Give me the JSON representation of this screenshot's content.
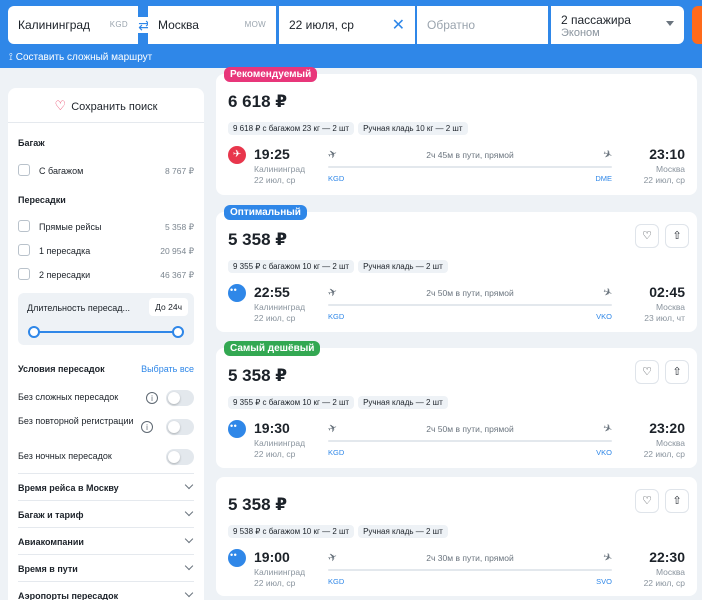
{
  "search": {
    "from": {
      "city": "Калининград",
      "code": "KGD"
    },
    "to": {
      "city": "Москва",
      "code": "MOW"
    },
    "date": "22 июля, ср",
    "return_placeholder": "Обратно",
    "passengers": "2 пассажира",
    "class": "Эконом",
    "complex_route": "Составить сложный маршрут"
  },
  "sidebar": {
    "save_search": "Сохранить поиск",
    "baggage": {
      "title": "Багаж",
      "items": [
        {
          "label": "С багажом",
          "price": "8 767 ₽"
        }
      ]
    },
    "transfers": {
      "title": "Пересадки",
      "items": [
        {
          "label": "Прямые рейсы",
          "price": "5 358 ₽"
        },
        {
          "label": "1 пересадка",
          "price": "20 954 ₽"
        },
        {
          "label": "2 пересадки",
          "price": "46 367 ₽"
        }
      ]
    },
    "duration": {
      "label": "Длительность пересад...",
      "value": "До 24ч"
    },
    "conditions": {
      "title": "Условия пересадок",
      "select_all": "Выбрать все",
      "items": [
        {
          "label": "Без сложных пересадок"
        },
        {
          "label": "Без повторной регистрации"
        },
        {
          "label": "Без ночных пересадок"
        }
      ]
    },
    "accordions": [
      "Время рейса в Москву",
      "Багаж и тариф",
      "Авиакомпании",
      "Время в пути",
      "Аэропорты пересадок"
    ]
  },
  "results": [
    {
      "badge": "Рекомендуемый",
      "badge_color": "#e8367a",
      "price": "6 618 ₽",
      "tags": [
        "9 618 ₽ с багажом 23 кг — 2 шт",
        "Ручная кладь 10 кг — 2 шт"
      ],
      "dep_time": "19:25",
      "dep_city": "Калининград",
      "dep_date": "22 июл, ср",
      "dep_code": "KGD",
      "duration": "2ч 45м в пути, прямой",
      "arr_time": "23:10",
      "arr_city": "Москва",
      "arr_date": "22 июл, ср",
      "arr_code": "DME",
      "airline": "red"
    },
    {
      "badge": "Оптимальный",
      "badge_color": "#2f87e8",
      "price": "5 358 ₽",
      "tags": [
        "9 355 ₽ с багажом 10 кг — 2 шт",
        "Ручная кладь — 2 шт"
      ],
      "dep_time": "22:55",
      "dep_city": "Калининград",
      "dep_date": "22 июл, ср",
      "dep_code": "KGD",
      "duration": "2ч 50м в пути, прямой",
      "arr_time": "02:45",
      "arr_city": "Москва",
      "arr_date": "23 июл, чт",
      "arr_code": "VKO",
      "airline": "blue"
    },
    {
      "badge": "Самый дешёвый",
      "badge_color": "#33a852",
      "price": "5 358 ₽",
      "tags": [
        "9 355 ₽ с багажом 10 кг — 2 шт",
        "Ручная кладь — 2 шт"
      ],
      "dep_time": "19:30",
      "dep_city": "Калининград",
      "dep_date": "22 июл, ср",
      "dep_code": "KGD",
      "duration": "2ч 50м в пути, прямой",
      "arr_time": "23:20",
      "arr_city": "Москва",
      "arr_date": "22 июл, ср",
      "arr_code": "VKO",
      "airline": "blue"
    },
    {
      "badge": "",
      "badge_color": "",
      "price": "5 358 ₽",
      "tags": [
        "9 538 ₽ с багажом 10 кг — 2 шт",
        "Ручная кладь — 2 шт"
      ],
      "dep_time": "19:00",
      "dep_city": "Калининград",
      "dep_date": "22 июл, ср",
      "dep_code": "KGD",
      "duration": "2ч 30м в пути, прямой",
      "arr_time": "22:30",
      "arr_city": "Москва",
      "arr_date": "22 июл, ср",
      "arr_code": "SVO",
      "airline": "blue"
    }
  ]
}
